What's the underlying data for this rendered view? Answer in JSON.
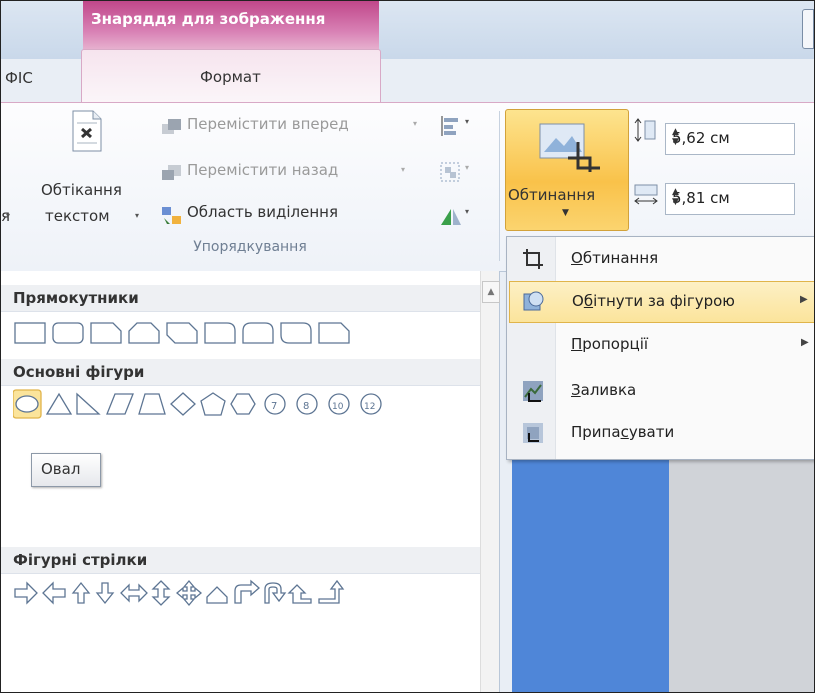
{
  "window": {
    "context_group": "Знаряддя для зображення"
  },
  "tabs": {
    "prev_tab": "ФІС",
    "format_tab": "Формат"
  },
  "arrange": {
    "bring_forward": "Перемістити вперед",
    "send_backward": "Перемістити назад",
    "selection_pane": "Область виділення",
    "wrap_line1": "Обтікання",
    "wrap_line2": "текстом",
    "cut_label": "я",
    "group_label": "Упорядкування"
  },
  "size": {
    "crop_label": "Обтинання",
    "height_value": "5,62 см",
    "width_value": "5,81 см"
  },
  "crop_menu": {
    "items": [
      {
        "label_pre": "",
        "label_u": "О",
        "label_post": "бтинання",
        "submenu": false
      },
      {
        "label_pre": "О",
        "label_u": "б",
        "label_post": "ітнути за фігурою",
        "submenu": true
      },
      {
        "label_pre": "",
        "label_u": "П",
        "label_post": "ропорції",
        "submenu": true
      },
      {
        "label_pre": "",
        "label_u": "З",
        "label_post": "аливка",
        "submenu": false
      },
      {
        "label_pre": "Припа",
        "label_u": "с",
        "label_post": "увати",
        "submenu": false
      }
    ]
  },
  "gallery": {
    "sections": [
      "Прямокутники",
      "Основні фігури",
      "Фігурні стрілки"
    ],
    "tooltip": "Овал"
  },
  "colors": {
    "accent_pink": "#c0478a",
    "highlight": "#fbe49b",
    "doc_blue": "#4f86d8"
  }
}
